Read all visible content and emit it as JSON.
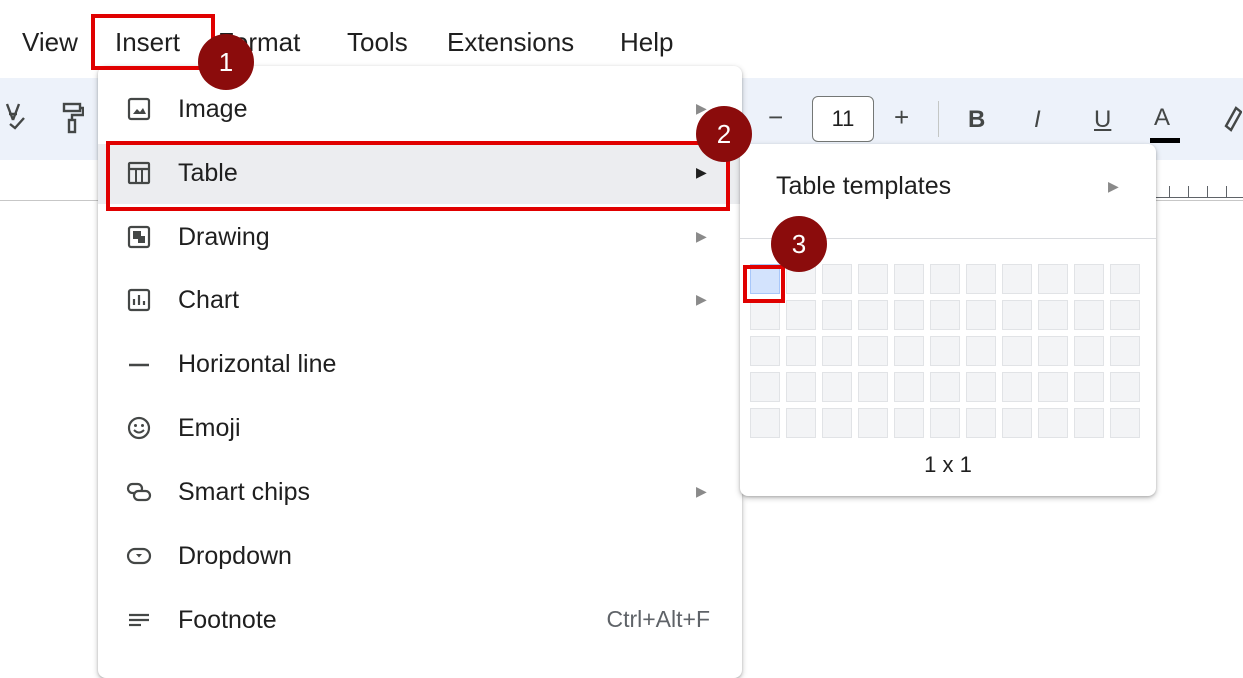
{
  "menubar": {
    "items": [
      "View",
      "Insert",
      "Format",
      "Tools",
      "Extensions",
      "Help"
    ]
  },
  "toolbar": {
    "minus": "−",
    "font_size": "11",
    "plus": "+",
    "bold": "B",
    "italic": "I",
    "underline": "U",
    "text_color": "A"
  },
  "insert_menu": {
    "items": [
      {
        "label": "Image",
        "icon": "image-icon",
        "has_submenu": true
      },
      {
        "label": "Table",
        "icon": "table-icon",
        "has_submenu": true,
        "selected": true
      },
      {
        "label": "Drawing",
        "icon": "drawing-icon",
        "has_submenu": true
      },
      {
        "label": "Chart",
        "icon": "chart-icon",
        "has_submenu": true
      },
      {
        "label": "Horizontal line",
        "icon": "horizontal-line-icon",
        "has_submenu": false
      },
      {
        "label": "Emoji",
        "icon": "emoji-icon",
        "has_submenu": false
      },
      {
        "label": "Smart chips",
        "icon": "smart-chips-icon",
        "has_submenu": true
      },
      {
        "label": "Dropdown",
        "icon": "dropdown-icon",
        "has_submenu": false
      },
      {
        "label": "Footnote",
        "icon": "footnote-icon",
        "has_submenu": false,
        "shortcut": "Ctrl+Alt+F"
      }
    ]
  },
  "table_submenu": {
    "templates_label": "Table templates",
    "grid_size_label": "1 x 1",
    "selected_rows": 1,
    "selected_cols": 1
  },
  "annotations": {
    "badge1": "1",
    "badge2": "2",
    "badge3": "3",
    "highlight_color": "#e00000",
    "badge_color": "#8b0c0c"
  }
}
